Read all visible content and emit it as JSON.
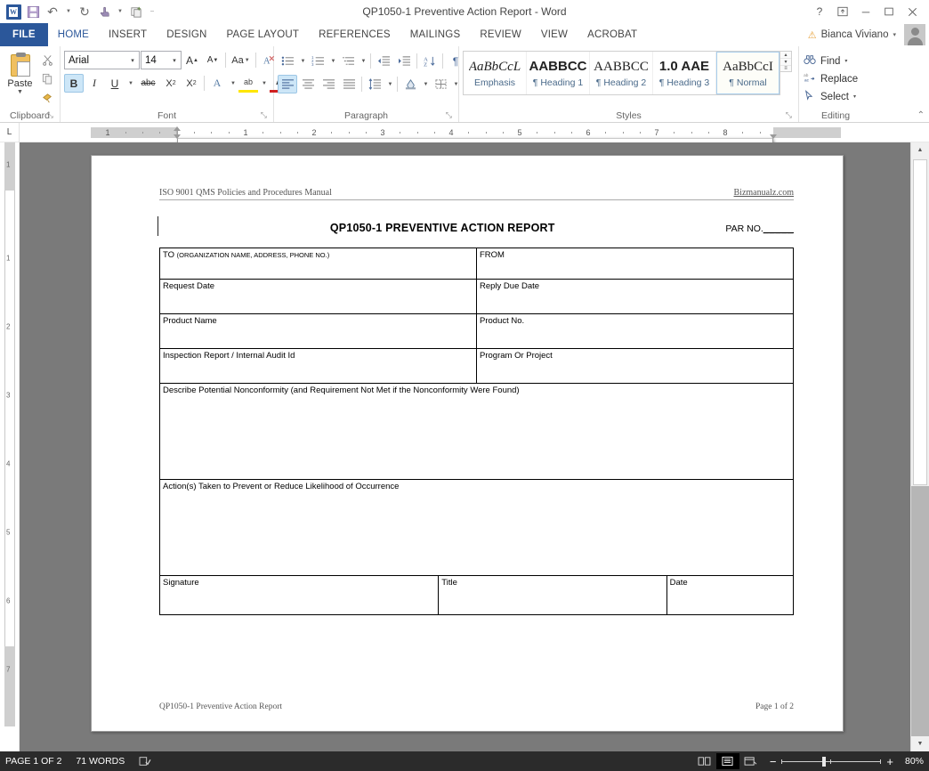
{
  "titlebar": {
    "document_title": "QP1050-1 Preventive Action Report - Word",
    "qat": [
      {
        "name": "word-logo",
        "glyph": "W"
      },
      {
        "name": "save-icon",
        "glyph": "💾"
      },
      {
        "name": "undo-icon",
        "glyph": "↶"
      },
      {
        "name": "undo-dropdown-icon",
        "glyph": "▾"
      },
      {
        "name": "redo-icon",
        "glyph": "↻"
      },
      {
        "name": "touch-mode-icon",
        "glyph": "👆"
      },
      {
        "name": "touch-dropdown-icon",
        "glyph": "▾"
      },
      {
        "name": "customize-qat-icon",
        "glyph": "❐"
      },
      {
        "name": "qat-more-icon",
        "glyph": "≡"
      }
    ],
    "window_buttons": [
      {
        "name": "help-button",
        "glyph": "?"
      },
      {
        "name": "ribbon-display-options-button",
        "glyph": "⤒"
      },
      {
        "name": "minimize-button",
        "glyph": "─"
      },
      {
        "name": "restore-button",
        "glyph": "☐"
      },
      {
        "name": "close-button",
        "glyph": "✕"
      }
    ]
  },
  "tabs": [
    {
      "label": "FILE",
      "id": "file"
    },
    {
      "label": "HOME",
      "id": "home"
    },
    {
      "label": "INSERT",
      "id": "insert"
    },
    {
      "label": "DESIGN",
      "id": "design"
    },
    {
      "label": "PAGE LAYOUT",
      "id": "page-layout"
    },
    {
      "label": "REFERENCES",
      "id": "references"
    },
    {
      "label": "MAILINGS",
      "id": "mailings"
    },
    {
      "label": "REVIEW",
      "id": "review"
    },
    {
      "label": "VIEW",
      "id": "view"
    },
    {
      "label": "ACROBAT",
      "id": "acrobat"
    }
  ],
  "active_tab": "HOME",
  "account": {
    "name": "Bianca Viviano",
    "warning_glyph": "⚠",
    "dropdown_glyph": "▾"
  },
  "ribbon": {
    "clipboard": {
      "label": "Clipboard",
      "paste_label": "Paste",
      "paste_arrow": "▼",
      "cut_glyph": "✂",
      "copy_glyph": "⧉",
      "format_painter_glyph": "🖌",
      "launcher_glyph": "⤡"
    },
    "font": {
      "label": "Font",
      "font_name": "Arial",
      "font_size": "14",
      "dropdown_glyph": "▾",
      "grow_font_glyph": "A▴",
      "shrink_font_glyph": "A▾",
      "change_case_glyph": "Aa",
      "clear_formatting_glyph": "A⊘",
      "bold_glyph": "B",
      "italic_glyph": "I",
      "underline_glyph": "U",
      "strikethrough_glyph": "abc",
      "subscript_glyph": "X₂",
      "superscript_glyph": "X²",
      "text_effects_glyph": "A",
      "highlight_glyph": "ab",
      "font_color_glyph": "A",
      "launcher_glyph": "⤡"
    },
    "paragraph": {
      "label": "Paragraph",
      "bullets_glyph": "☷",
      "numbering_glyph": "☷",
      "multilevel_glyph": "☷",
      "decrease_indent_glyph": "⇤",
      "increase_indent_glyph": "⇥",
      "sort_glyph": "A↓",
      "show_marks_glyph": "¶",
      "align_left_glyph": "≡",
      "align_center_glyph": "≡",
      "align_right_glyph": "≡",
      "justify_glyph": "≡",
      "line_spacing_glyph": "↕",
      "shading_glyph": "▣",
      "borders_glyph": "⊞",
      "launcher_glyph": "⤡"
    },
    "styles": {
      "label": "Styles",
      "launcher_glyph": "⤡",
      "items": [
        {
          "preview": "AaBbCcL",
          "name": "Emphasis",
          "selected": false,
          "mark": ""
        },
        {
          "preview": "AABBCC",
          "name": "Heading 1",
          "selected": false,
          "mark": "¶"
        },
        {
          "preview": "AABBCC",
          "name": "Heading 2",
          "selected": false,
          "mark": "¶"
        },
        {
          "preview": "1.0  AAE",
          "name": "Heading 3",
          "selected": false,
          "mark": "¶"
        },
        {
          "preview": "AaBbCcI",
          "name": "Normal",
          "selected": true,
          "mark": "¶"
        }
      ],
      "scroll_up_glyph": "▴",
      "scroll_down_glyph": "▾",
      "more_glyph": "≡"
    },
    "editing": {
      "label": "Editing",
      "find_label": "Find",
      "find_glyph": "🔍",
      "find_dropdown": "▾",
      "replace_label": "Replace",
      "replace_glyph": "ab",
      "select_label": "Select",
      "select_glyph": "↱",
      "select_dropdown": "▾"
    },
    "collapse_glyph": "⌃"
  },
  "ruler": {
    "tab_stop_glyph": "L",
    "h_numbers": [
      "1",
      "2",
      "3",
      "4",
      "5",
      "6",
      "7",
      "8"
    ],
    "v_numbers": [
      "1",
      "2",
      "3",
      "4",
      "5",
      "6",
      "7"
    ]
  },
  "document": {
    "header_left": "ISO 9001 QMS Policies and Procedures Manual",
    "header_right": "Bizmanualz.com",
    "title": "QP1050-1 PREVENTIVE ACTION REPORT",
    "par_no_label": "PAR NO.",
    "par_no_blank": "_____",
    "table": {
      "row_to_from": {
        "to_label": "TO",
        "to_sub": "(ORGANIZATION NAME, ADDRESS, PHONE NO.)",
        "from_label": "FROM"
      },
      "row_dates": {
        "left": "Request Date",
        "right": "Reply Due Date"
      },
      "row_product": {
        "left": "Product Name",
        "right": "Product No."
      },
      "row_inspection": {
        "left": "Inspection Report / Internal Audit Id",
        "right": "Program Or Project"
      },
      "row_describe": "Describe Potential Nonconformity (and Requirement Not Met if the Nonconformity Were Found)",
      "row_actions": "Action(s) Taken to Prevent or Reduce Likelihood of Occurrence",
      "row_signature": {
        "signature": "Signature",
        "title": "Title",
        "date": "Date"
      }
    },
    "footer_left": "QP1050-1 Preventive Action Report",
    "footer_right": "Page 1 of 2"
  },
  "status_bar": {
    "page_indicator": "PAGE 1 OF 2",
    "word_count": "71 WORDS",
    "proofing_glyph": "📖",
    "views": [
      {
        "name": "read-mode-view-button",
        "glyph": "📖",
        "selected": false
      },
      {
        "name": "print-layout-view-button",
        "glyph": "▤",
        "selected": true
      },
      {
        "name": "web-layout-view-button",
        "glyph": "▥",
        "selected": false
      }
    ],
    "zoom_out_glyph": "−",
    "zoom_in_glyph": "+",
    "zoom_level": "80%"
  }
}
